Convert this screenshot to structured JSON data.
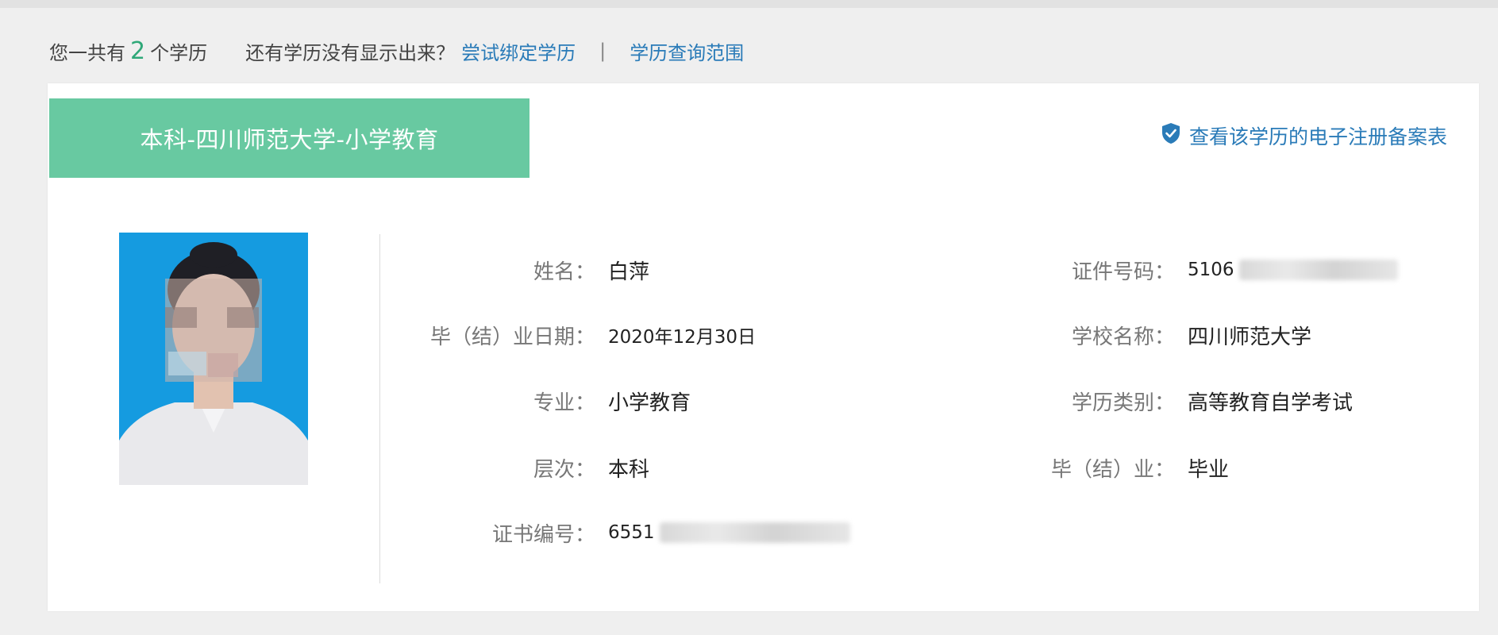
{
  "summary": {
    "prefix": "您一共有",
    "count": "2",
    "suffix": "个学历",
    "question": "还有学历没有显示出来？",
    "bind_link": "尝试绑定学历",
    "separator": "|",
    "scope_link": "学历查询范围"
  },
  "card": {
    "banner_title": "本科-四川师范大学-小学教育",
    "verify_link": "查看该学历的电子注册备案表",
    "verify_icon": "shield-check-icon",
    "left_fields": [
      {
        "label": "姓名：",
        "value": "白萍"
      },
      {
        "label": "毕（结）业日期：",
        "value": "2020年12月30日"
      },
      {
        "label": "专业：",
        "value": "小学教育"
      },
      {
        "label": "层次：",
        "value": "本科"
      },
      {
        "label": "证书编号：",
        "value": "6551"
      }
    ],
    "right_fields": [
      {
        "label": "证件号码：",
        "value": "5106"
      },
      {
        "label": "学校名称：",
        "value": "四川师范大学"
      },
      {
        "label": "学历类别：",
        "value": "高等教育自学考试"
      },
      {
        "label": "毕（结）业：",
        "value": "毕业"
      }
    ]
  },
  "colors": {
    "banner": "#68c9a1",
    "link": "#2a7bb8",
    "count": "#2fa878",
    "photo_bg": "#159be0"
  }
}
